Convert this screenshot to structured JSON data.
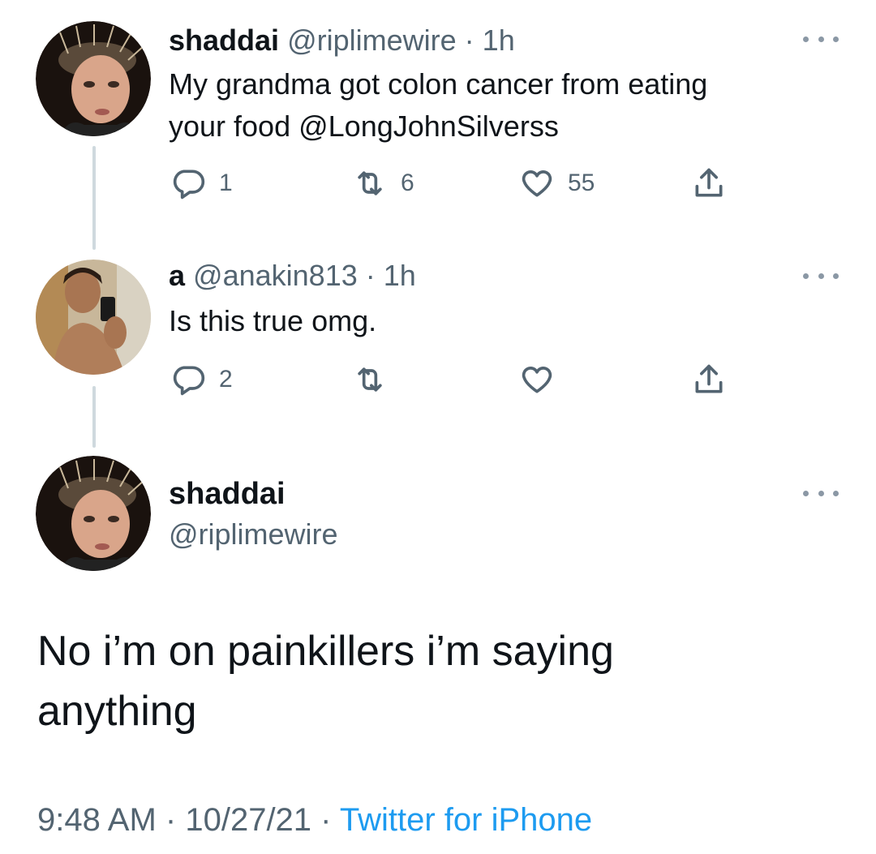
{
  "reply1": {
    "name": "shaddai",
    "handle": "@riplimewire",
    "separator": "·",
    "time": "1h",
    "text_line1": "My grandma got colon cancer from eating",
    "text_line2": "your food @LongJohnSilverss",
    "reply_count": "1",
    "retweet_count": "6",
    "like_count": "55"
  },
  "reply2": {
    "name": "a",
    "handle": "@anakin813",
    "separator": "·",
    "time": "1h",
    "text": "Is this true omg.",
    "reply_count": "2",
    "retweet_count": "",
    "like_count": ""
  },
  "main_tweet": {
    "name": "shaddai",
    "handle": "@riplimewire",
    "text_line1": "No i’m on painkillers i’m saying",
    "text_line2": "anything",
    "time": "9:48 AM",
    "separator": "·",
    "date": "10/27/21",
    "source": "Twitter for iPhone"
  },
  "colors": {
    "text": "#0f1419",
    "secondary": "#536471",
    "link": "#1d9bf0",
    "thread_line": "#cfd9de"
  },
  "icons": {
    "reply": "reply-icon",
    "retweet": "retweet-icon",
    "like": "heart-icon",
    "share": "share-icon",
    "more": "more-icon"
  }
}
